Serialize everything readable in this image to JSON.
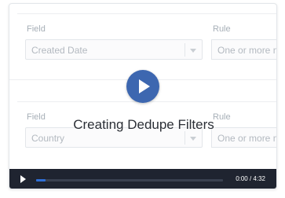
{
  "video": {
    "title": "Creating Dedupe Filters",
    "time_display": "0:00 / 4:32",
    "progress_fraction": 0.05
  },
  "form": {
    "rows": [
      {
        "field_label": "Field",
        "field_value": "Created Date",
        "rule_label": "Rule",
        "rule_value": "One or more n"
      },
      {
        "field_label": "Field",
        "field_value": "Country",
        "rule_label": "Rule",
        "rule_value": "One or more m"
      }
    ]
  },
  "colors": {
    "play_button": "#3d67b0",
    "control_bar": "#1f2430",
    "progress_fill": "#2f6fd6"
  },
  "icons": {
    "big_play": "play-icon",
    "control_play": "play-icon",
    "select_caret": "chevron-down-icon"
  }
}
